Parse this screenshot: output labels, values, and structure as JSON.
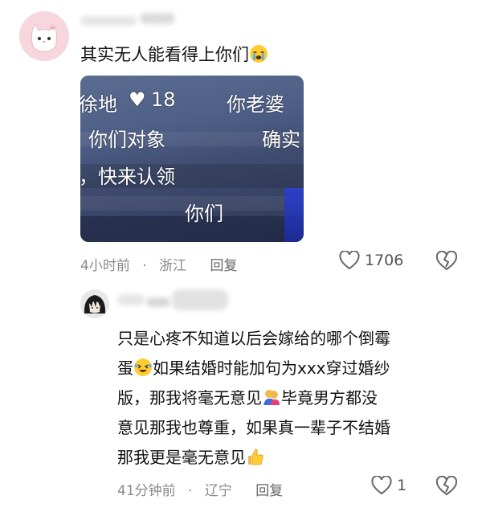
{
  "comment": {
    "text": "其实无人能看得上你们",
    "emoji": "crying-face",
    "image_subtitles": {
      "line1_a": "徐地",
      "line1_likes": "18",
      "line1_b": "你老婆",
      "line2_a": "你们对象",
      "line2_b": "确实",
      "line3": "，快来认领",
      "line4": "你们"
    },
    "meta": {
      "time": "4小时前",
      "separator": "·",
      "location": "浙江",
      "reply": "回复"
    },
    "likes": "1706"
  },
  "reply": {
    "text_line1": "只是心疼不知道以后会嫁给的哪个倒霉",
    "text_line2_a": "蛋",
    "text_line2_b": "如果结婚时能加句为xxx穿过婚纱",
    "text_line3_a": "版，那我将毫无意见",
    "text_line3_b": "毕竟男方都没",
    "text_line4": "意见那我也尊重，如果真一辈子不结婚",
    "text_line5": "那我更是毫无意见",
    "meta": {
      "time": "41分钟前",
      "separator": "·",
      "location": "辽宁",
      "reply": "回复"
    },
    "likes": "1"
  },
  "colors": {
    "meta_gray": "#8a8a8a",
    "avatar_pink": "#f7d6dd",
    "image_blue": "#4f6088"
  }
}
